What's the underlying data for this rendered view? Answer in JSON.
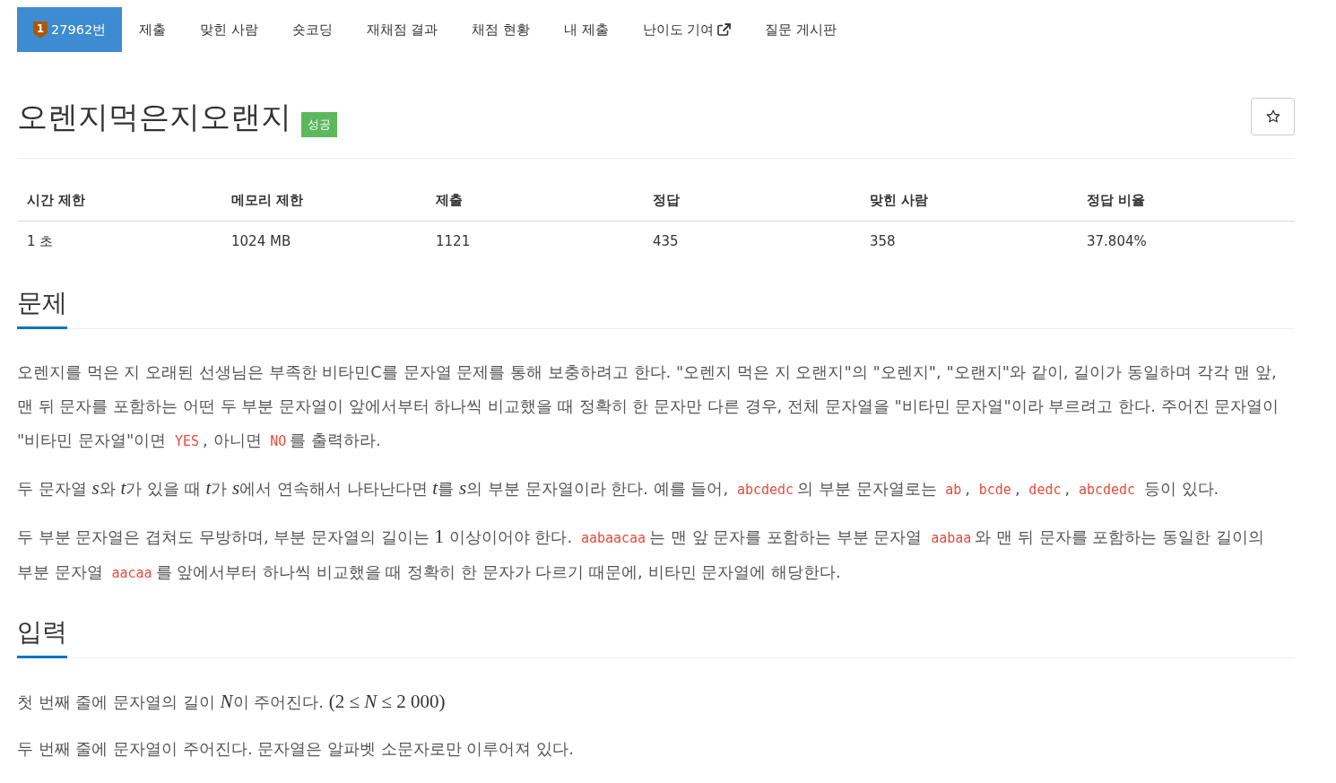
{
  "nav": {
    "tabs": [
      {
        "label": "27962번",
        "tier_badge": "1",
        "external": false,
        "selected": true
      },
      {
        "label": "제출",
        "external": false,
        "selected": false
      },
      {
        "label": "맞힌 사람",
        "external": false,
        "selected": false
      },
      {
        "label": "숏코딩",
        "external": false,
        "selected": false
      },
      {
        "label": "재채점 결과",
        "external": false,
        "selected": false
      },
      {
        "label": "채점 현황",
        "external": false,
        "selected": false
      },
      {
        "label": "내 제출",
        "external": false,
        "selected": false
      },
      {
        "label": "난이도 기여",
        "external": true,
        "selected": false
      },
      {
        "label": "질문 게시판",
        "external": false,
        "selected": false
      }
    ]
  },
  "problem": {
    "title": "오렌지먹은지오랜지",
    "status": {
      "label": "성공",
      "kind": "success"
    }
  },
  "info_table": {
    "columns": [
      "시간 제한",
      "메모리 제한",
      "제출",
      "정답",
      "맞힌 사람",
      "정답 비율"
    ],
    "rows": [
      [
        "1 초",
        "1024 MB",
        "1121",
        "435",
        "358",
        "37.804%"
      ]
    ]
  },
  "sections": [
    {
      "heading": "문제",
      "paragraphs": [
        [
          {
            "kind": "text",
            "text": "오렌지를 먹은 지 오래된 선생님은 부족한 비타민C를 문자열 문제를 통해 보충하려고 한다. \"오렌지 먹은 지 오랜지\"의 \"오렌지\", \"오랜지\"와 같이, 길이가 동일하며 각각 맨 앞, 맨 뒤 문자를 포함하는 어떤 두 부분 문자열이 앞에서부터 하나씩 비교했을 때 정확히 한 문자만 다른 경우, 전체 문자열을 \"비타민 문자열\"이라 부르려고 한다. 주어진 문자열이 \"비타민 문자열\"이면 "
          },
          {
            "kind": "code",
            "text": "YES"
          },
          {
            "kind": "text",
            "text": ", 아니면 "
          },
          {
            "kind": "code",
            "text": "NO"
          },
          {
            "kind": "text",
            "text": "를 출력하라."
          }
        ],
        [
          {
            "kind": "text",
            "text": "두 문자열 "
          },
          {
            "kind": "math",
            "text": "*s*"
          },
          {
            "kind": "text",
            "text": "와 "
          },
          {
            "kind": "math",
            "text": "*t*"
          },
          {
            "kind": "text",
            "text": "가 있을 때 "
          },
          {
            "kind": "math",
            "text": "*t*"
          },
          {
            "kind": "text",
            "text": "가 "
          },
          {
            "kind": "math",
            "text": "*s*"
          },
          {
            "kind": "text",
            "text": "에서 연속해서 나타난다면 "
          },
          {
            "kind": "math",
            "text": "*t*"
          },
          {
            "kind": "text",
            "text": "를 "
          },
          {
            "kind": "math",
            "text": "*s*"
          },
          {
            "kind": "text",
            "text": "의 부분 문자열이라 한다. 예를 들어, "
          },
          {
            "kind": "code",
            "text": "abcdedc"
          },
          {
            "kind": "text",
            "text": "의 부분 문자열로는 "
          },
          {
            "kind": "code",
            "text": "ab"
          },
          {
            "kind": "text",
            "text": ", "
          },
          {
            "kind": "code",
            "text": "bcde"
          },
          {
            "kind": "text",
            "text": ", "
          },
          {
            "kind": "code",
            "text": "dedc"
          },
          {
            "kind": "text",
            "text": ", "
          },
          {
            "kind": "code",
            "text": "abcdedc"
          },
          {
            "kind": "text",
            "text": " 등이 있다."
          }
        ],
        [
          {
            "kind": "text",
            "text": "두 부분 문자열은 겹쳐도 무방하며, 부분 문자열의 길이는 "
          },
          {
            "kind": "math",
            "text": "1"
          },
          {
            "kind": "text",
            "text": " 이상이어야 한다. "
          },
          {
            "kind": "code",
            "text": "aabaacaa"
          },
          {
            "kind": "text",
            "text": "는 맨 앞 문자를 포함하는 부분 문자열 "
          },
          {
            "kind": "code",
            "text": "aabaa"
          },
          {
            "kind": "text",
            "text": "와 맨 뒤 문자를 포함하는 동일한 길이의 부분 문자열 "
          },
          {
            "kind": "code",
            "text": "aacaa"
          },
          {
            "kind": "text",
            "text": "를 앞에서부터 하나씩 비교했을 때 정확히 한 문자가 다르기 때문에, 비타민 문자열에 해당한다."
          }
        ]
      ]
    },
    {
      "heading": "입력",
      "paragraphs": [
        [
          {
            "kind": "text",
            "text": "첫 번째 줄에 문자열의 길이 "
          },
          {
            "kind": "math",
            "text": "*N*"
          },
          {
            "kind": "text",
            "text": "이 주어진다. "
          },
          {
            "kind": "math",
            "text": "(2 ≤ *N* ≤ 2 000)"
          }
        ],
        [
          {
            "kind": "text",
            "text": "두 번째 줄에 문자열이 주어진다. 문자열은 알파벳 소문자로만 이루어져 있다."
          }
        ]
      ]
    }
  ]
}
